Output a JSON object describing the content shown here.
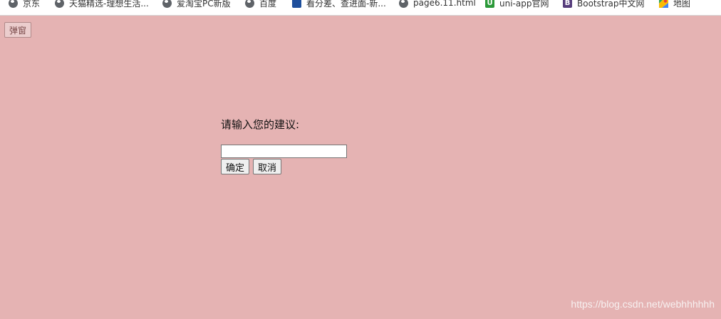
{
  "bookmarks": [
    {
      "label": "京东",
      "icon": "globe-icon"
    },
    {
      "label": "天猫精选-理想生活...",
      "icon": "globe-icon"
    },
    {
      "label": "爱淘宝PC新版",
      "icon": "globe-icon"
    },
    {
      "label": "百度",
      "icon": "globe-icon"
    },
    {
      "label": "看分差、查进面-新...",
      "icon": "site-logo-icon"
    },
    {
      "label": "page6.11.html",
      "icon": "globe-icon"
    },
    {
      "label": "uni-app官网",
      "icon": "uniapp-logo-icon",
      "glyph": "U",
      "color": "#2b9939"
    },
    {
      "label": "Bootstrap中文网",
      "icon": "bootstrap-logo-icon",
      "glyph": "B",
      "color": "#563d7c"
    },
    {
      "label": "地图",
      "icon": "maps-icon"
    }
  ],
  "popup_button": {
    "label": "弹窗"
  },
  "dialog": {
    "prompt": "请输入您的建议:",
    "input_value": "",
    "confirm_label": "确定",
    "cancel_label": "取消"
  },
  "watermark": "https://blog.csdn.net/webhhhhhh",
  "colors": {
    "page_background": "#e5b3b3",
    "bookmarks_bar": "#ffffff"
  }
}
